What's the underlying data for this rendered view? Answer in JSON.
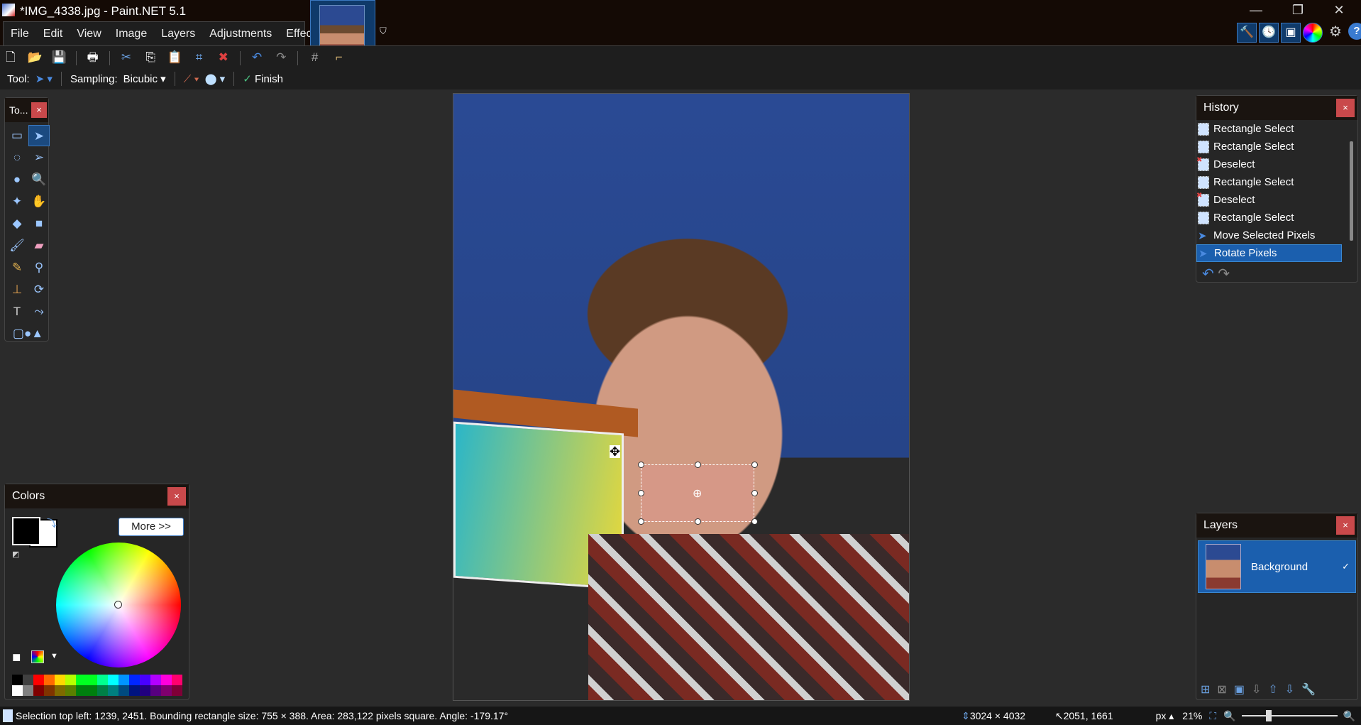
{
  "window": {
    "title": "*IMG_4338.jpg - Paint.NET 5.1",
    "minimize": "—",
    "restore": "❐",
    "close": "✕"
  },
  "menu": [
    "File",
    "Edit",
    "View",
    "Image",
    "Layers",
    "Adjustments",
    "Effects"
  ],
  "toolbar": {
    "tool_label": "Tool:",
    "sampling_label": "Sampling:",
    "sampling_value": "Bicubic",
    "finish_label": "Finish"
  },
  "tools_panel": {
    "title": "To...",
    "close": "×"
  },
  "history": {
    "title": "History",
    "close": "×",
    "items": [
      {
        "label": "Rectangle Select",
        "icon": "rectangle-select"
      },
      {
        "label": "Rectangle Select",
        "icon": "rectangle-select"
      },
      {
        "label": "Deselect",
        "icon": "deselect"
      },
      {
        "label": "Rectangle Select",
        "icon": "rectangle-select"
      },
      {
        "label": "Deselect",
        "icon": "deselect"
      },
      {
        "label": "Rectangle Select",
        "icon": "rectangle-select"
      },
      {
        "label": "Move Selected Pixels",
        "icon": "move-selection"
      },
      {
        "label": "Rotate Pixels",
        "icon": "move-selection",
        "selected": true
      }
    ]
  },
  "layers": {
    "title": "Layers",
    "close": "×",
    "items": [
      {
        "name": "Background",
        "visible": true
      }
    ]
  },
  "colors": {
    "title": "Colors",
    "close": "×",
    "more_label": "More >>",
    "primary": "#000000",
    "secondary": "#ffffff",
    "palette_top": [
      "#000000",
      "#404040",
      "#ff0000",
      "#ff6a00",
      "#ffd800",
      "#b6ff00",
      "#00ff21",
      "#00ff21",
      "#00ff90",
      "#00ffff",
      "#0094ff",
      "#0026ff",
      "#4800ff",
      "#b200ff",
      "#ff00dc",
      "#ff006e"
    ],
    "palette_bottom": [
      "#ffffff",
      "#808080",
      "#7f0000",
      "#7f3300",
      "#7f6a00",
      "#5b7f00",
      "#007f0e",
      "#007f0e",
      "#007f46",
      "#007f7f",
      "#004a7f",
      "#00137f",
      "#21007f",
      "#57007f",
      "#7f006e",
      "#7f0037"
    ]
  },
  "status": {
    "selection_info": "Selection top left: 1239, 2451. Bounding rectangle size: 755 × 388. Area: 283,122 pixels square. Angle: -179.17°",
    "image_size": "3024 × 4032",
    "cursor_pos": "2051, 1661",
    "units": "px",
    "zoom": "21%",
    "zoom_level_percent": 21
  },
  "accent": "#1b5fae"
}
